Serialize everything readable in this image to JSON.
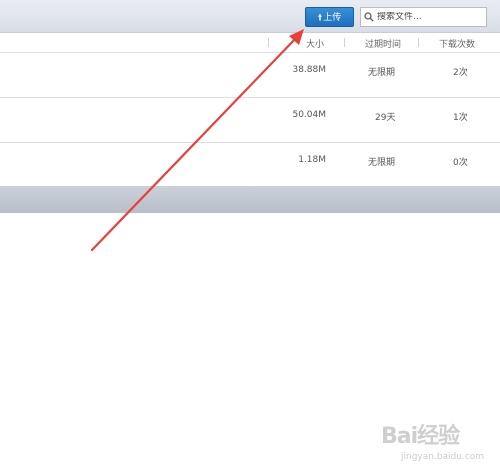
{
  "toolbar": {
    "upload_label": "上传",
    "search_placeholder": "搜索文件..."
  },
  "columns": {
    "size": "大小",
    "expiry": "过期时间",
    "downloads": "下载次数"
  },
  "files": [
    {
      "size": "38.88M",
      "expiry": "无限期",
      "downloads": "2次"
    },
    {
      "size": "50.04M",
      "expiry": "29天",
      "downloads": "1次"
    },
    {
      "size": "1.18M",
      "expiry": "无限期",
      "downloads": "0次"
    }
  ],
  "annotation": {
    "color": "#e8403a"
  },
  "watermark": {
    "logo_text": "Bai经验",
    "url": "jingyan.baidu.com"
  },
  "colors": {
    "primary": "#1d6fbf",
    "section_bar": "#bfc5ce"
  }
}
